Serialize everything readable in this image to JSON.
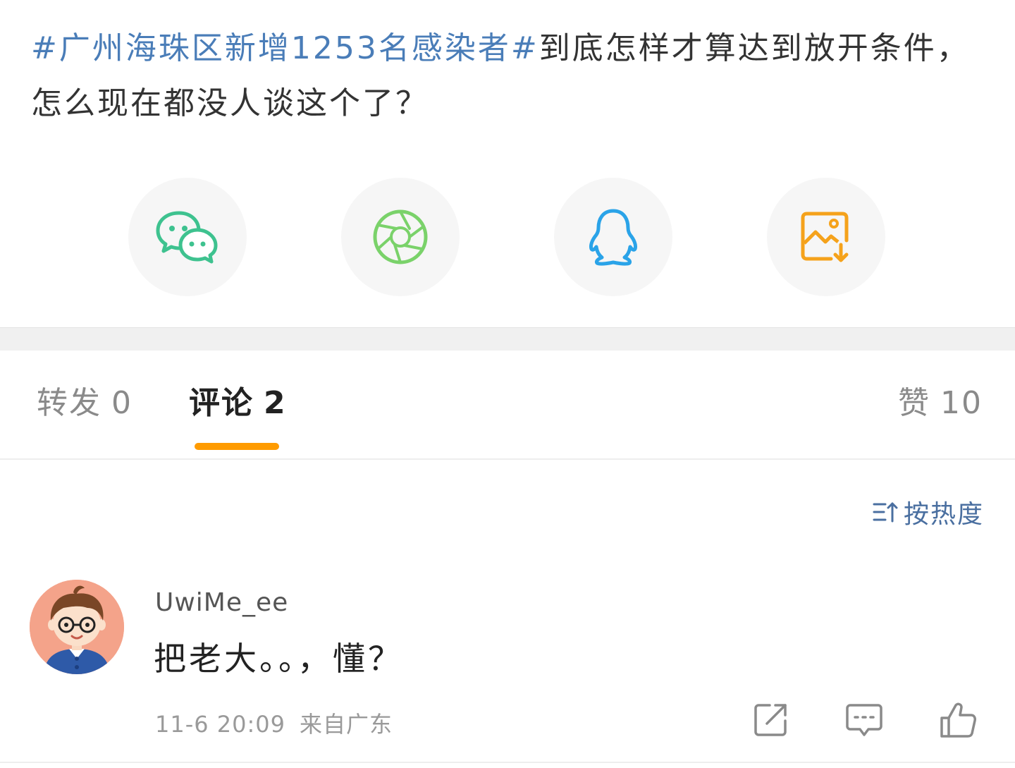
{
  "post": {
    "topic": "#广州海珠区新增1253名感染者#",
    "text": "到底怎样才算达到放开条件，怎么现在都没人谈这个了？"
  },
  "share": [
    {
      "icon": "wechat-icon",
      "color": "#3ec28f"
    },
    {
      "icon": "moments-icon",
      "color": "#7ad26a"
    },
    {
      "icon": "qq-icon",
      "color": "#2aa3e8"
    },
    {
      "icon": "save-image-icon",
      "color": "#f5a21b"
    }
  ],
  "tabs": {
    "repost": {
      "label": "转发",
      "count": "0"
    },
    "comment": {
      "label": "评论",
      "count": "2"
    },
    "like": {
      "label": "赞",
      "count": "10"
    }
  },
  "accent_color": "#ff9b00",
  "sort": {
    "label": "按热度"
  },
  "comment": {
    "username": "UwiMe_ee",
    "text": "把老大。。，懂？",
    "time": "11-6 20:09",
    "location": "来自广东"
  }
}
